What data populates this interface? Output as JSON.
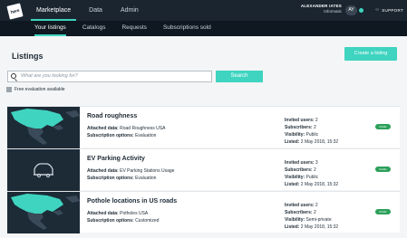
{
  "header": {
    "logo_text": "here",
    "nav": [
      {
        "label": "Marketplace",
        "active": true
      },
      {
        "label": "Data",
        "active": false
      },
      {
        "label": "Admin",
        "active": false
      }
    ],
    "user_name": "ALEXANDER IATES",
    "user_org": "Informatic",
    "avatar_initials": "AY",
    "support_label": "SUPPORT"
  },
  "subnav": [
    {
      "label": "Your listings",
      "active": true
    },
    {
      "label": "Catalogs",
      "active": false
    },
    {
      "label": "Requests",
      "active": false
    },
    {
      "label": "Subscriptions sold",
      "active": false
    }
  ],
  "page": {
    "title": "Listings",
    "create_button": "Create a listing",
    "search_placeholder": "What are you looking for?",
    "search_button": "Search",
    "free_eval_label": "Free evaluation available"
  },
  "labels": {
    "attached_data": "Attached data:",
    "subscription_options": "Subscription options:",
    "invited_users": "Invited users:",
    "subscribers": "Subscribers:",
    "visibility": "Visibility:",
    "listed": "Listed:"
  },
  "listings": [
    {
      "title": "Road roughness",
      "thumb": "map-icon",
      "attached_data": "Road Roughness USA",
      "subscription_options": "Evaluation",
      "invited_users": "2",
      "subscribers": "2",
      "visibility": "Public",
      "listed": "2 May 2018, 15:32",
      "status": "Public"
    },
    {
      "title": "EV Parking Activity",
      "thumb": "car-icon",
      "attached_data": "EV Parking Stations Usage",
      "subscription_options": "Evaluation",
      "invited_users": "3",
      "subscribers": "2",
      "visibility": "Public",
      "listed": "2 May 2018, 15:32",
      "status": "Public"
    },
    {
      "title": "Pothole locations in US roads",
      "thumb": "map-icon",
      "attached_data": "Potholes USA",
      "subscription_options": "Customized",
      "invited_users": "2",
      "subscribers": "2",
      "visibility": "Semi-private",
      "listed": "2 May 2018, 15:32",
      "status": "Public"
    }
  ],
  "colors": {
    "accent": "#3fd4c0",
    "topbar": "#1a2530",
    "subbar": "#0f1820",
    "toggle_on": "#2ca05a"
  }
}
